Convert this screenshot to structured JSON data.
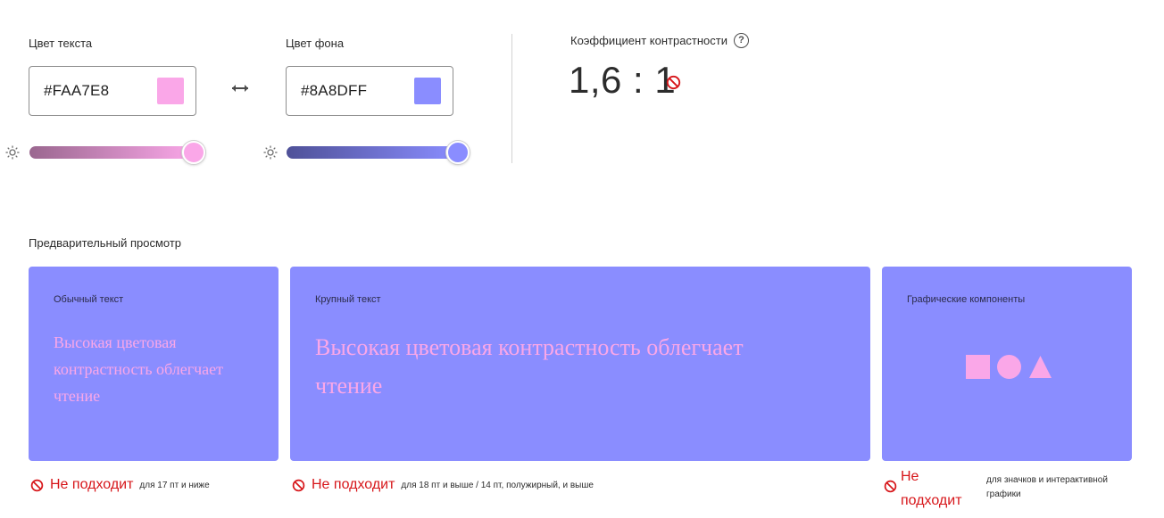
{
  "colors": {
    "text_color": "#FAA7E8",
    "background_color": "#8A8DFF",
    "fail_red": "#D7161A"
  },
  "text_color_field": {
    "label": "Цвет текста",
    "value": "#FAA7E8",
    "brightness_level": 1.0
  },
  "background_color_field": {
    "label": "Цвет фона",
    "value": "#8A8DFF",
    "brightness_level": 1.0
  },
  "contrast": {
    "label": "Коэффициент контрастности",
    "help_icon_glyph": "?",
    "ratio": "1,6 : 1",
    "status_icon": "fail-icon"
  },
  "preview": {
    "title": "Предварительный просмотр",
    "cards": {
      "normal": {
        "title": "Обычный текст",
        "sample": "Высокая цветовая контрастность облегчает чтение",
        "status": "Не подходит",
        "note": "для 17 пт и ниже"
      },
      "large": {
        "title": "Крупный текст",
        "sample": "Высокая цветовая контрастность облегчает чтение",
        "status": "Не подходит",
        "note": "для 18 пт и выше / 14 пт, полужирный, и выше"
      },
      "graphics": {
        "title": "Графические компоненты",
        "shapes": [
          "square",
          "circle",
          "triangle"
        ],
        "status": "Не подходит",
        "note": "для значков и интерактивной графики"
      }
    }
  }
}
